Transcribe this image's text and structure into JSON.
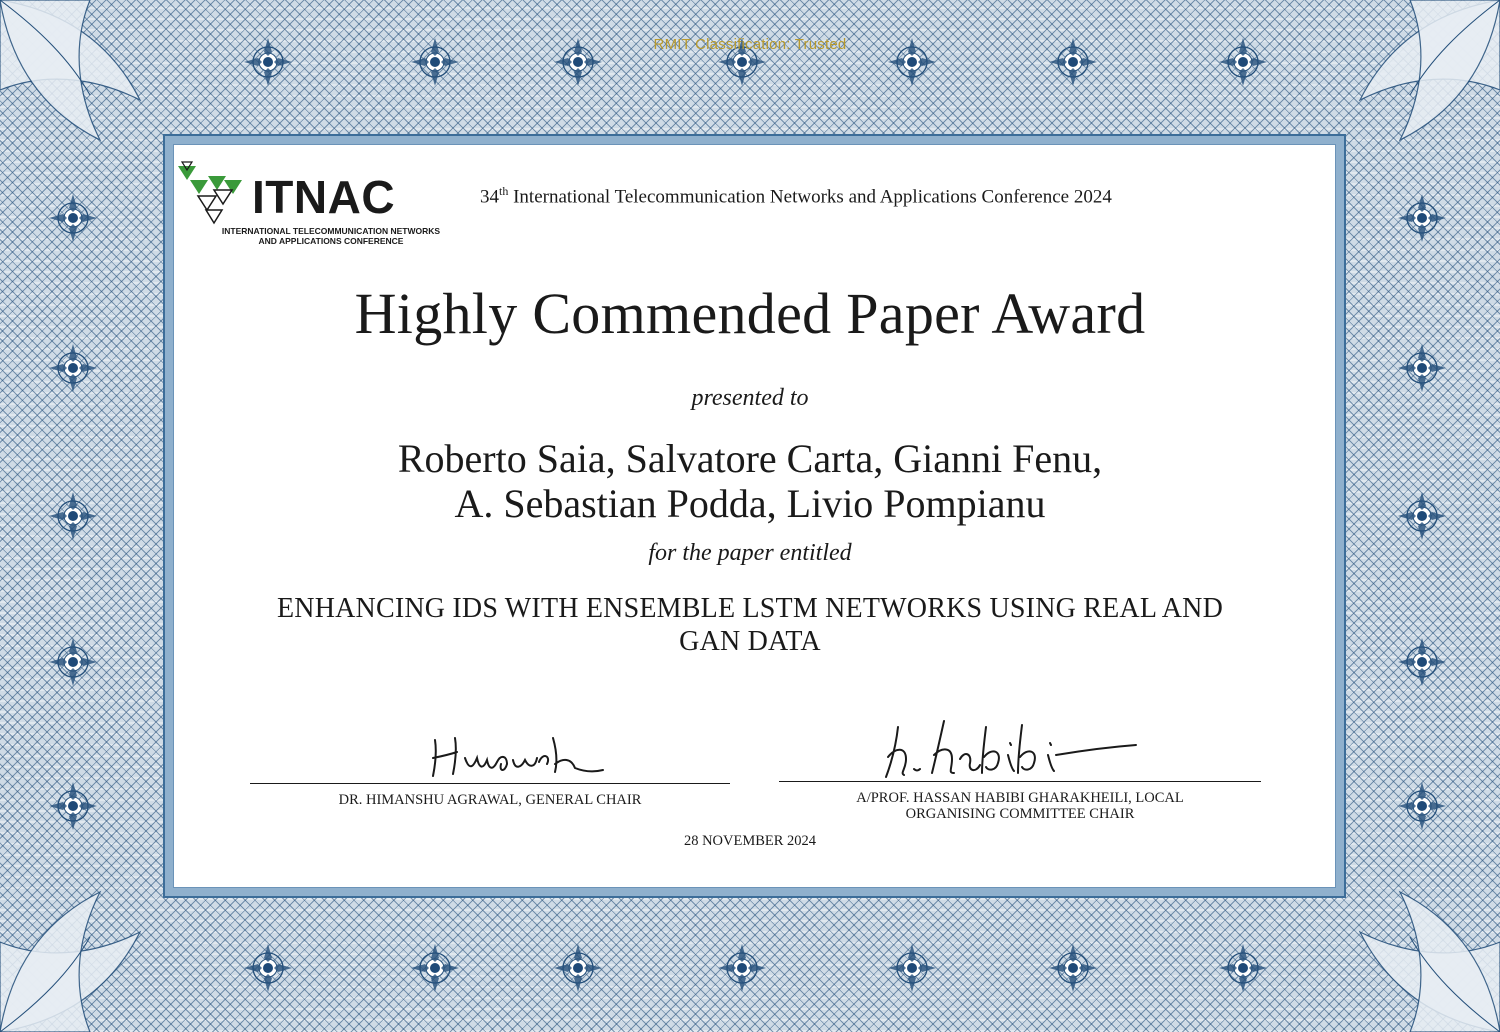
{
  "classification_label": "RMIT Classification: Trusted",
  "logo": {
    "wordmark": "ITNAC",
    "subtitle_line1": "INTERNATIONAL TELECOMMUNICATION NETWORKS",
    "subtitle_line2": "AND APPLICATIONS CONFERENCE",
    "icon": "triangles-logo-icon",
    "accent_color": "#3a9a3a"
  },
  "conference": {
    "ordinal_number": "34",
    "ordinal_suffix": "th",
    "name": "International Telecommunication Networks and Applications Conference 2024"
  },
  "award_title": "Highly Commended Paper Award",
  "presented_to": "presented to",
  "authors": {
    "line1": "Roberto Saia, Salvatore Carta, Gianni Fenu,",
    "line2": "A. Sebastian Podda, Livio Pompianu"
  },
  "for_the_paper": "for the paper entitled",
  "paper_title": {
    "line1": "ENHANCING IDS WITH ENSEMBLE LSTM NETWORKS USING REAL AND",
    "line2": "GAN DATA"
  },
  "signatories": [
    {
      "name": "DR. HIMANSHU AGRAWAL, GENERAL CHAIR",
      "signature": "Himanshu"
    },
    {
      "name_line1": "A/PROF. HASSAN HABIBI GHARAKHEILI, LOCAL",
      "name_line2": "ORGANISING COMMITTEE CHAIR",
      "signature": "h. habibi"
    }
  ],
  "date": "28 NOVEMBER 2024",
  "colors": {
    "frame_blue": "#244f7a",
    "text": "#1a1a1a",
    "classification_gold": "#b89a2e"
  }
}
